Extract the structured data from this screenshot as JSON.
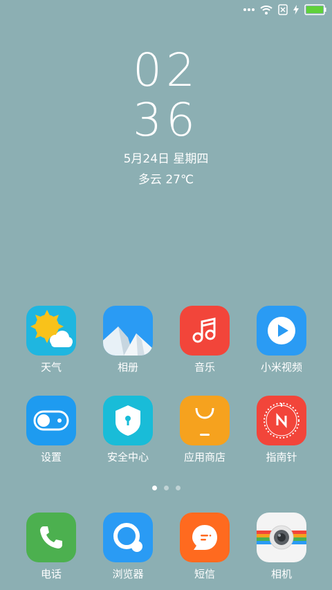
{
  "status_bar": {
    "icons": [
      "more-dots-icon",
      "wifi-icon",
      "no-sim-icon",
      "charging-icon",
      "battery-icon"
    ],
    "battery_color": "#5FD13A"
  },
  "clock": {
    "hour": "02",
    "minute": "36",
    "date": "5月24日 星期四",
    "weather": "多云 27℃"
  },
  "apps": [
    {
      "label": "天气",
      "icon": "weather-icon"
    },
    {
      "label": "相册",
      "icon": "gallery-icon"
    },
    {
      "label": "音乐",
      "icon": "music-icon"
    },
    {
      "label": "小米视频",
      "icon": "video-icon"
    },
    {
      "label": "设置",
      "icon": "settings-icon"
    },
    {
      "label": "安全中心",
      "icon": "security-icon"
    },
    {
      "label": "应用商店",
      "icon": "app-store-icon"
    },
    {
      "label": "指南针",
      "icon": "compass-icon"
    }
  ],
  "pager": {
    "pages": 3,
    "active": 1
  },
  "dock": [
    {
      "label": "电话",
      "icon": "phone-icon"
    },
    {
      "label": "浏览器",
      "icon": "browser-icon"
    },
    {
      "label": "短信",
      "icon": "messages-icon"
    },
    {
      "label": "相机",
      "icon": "camera-icon"
    }
  ],
  "colors": {
    "wallpaper": "#8CAFB3",
    "weather": "#1FB6E0",
    "gallery": "#2A9BF4",
    "music": "#F2453A",
    "video": "#2A9BF4",
    "settings": "#1E9BF0",
    "security": "#19BCD8",
    "app_store": "#F6A21E",
    "compass": "#F2453A",
    "phone": "#4CB04F",
    "browser": "#2A9BF4",
    "messages": "#FF6A1F",
    "camera": "#F4F4F4"
  }
}
